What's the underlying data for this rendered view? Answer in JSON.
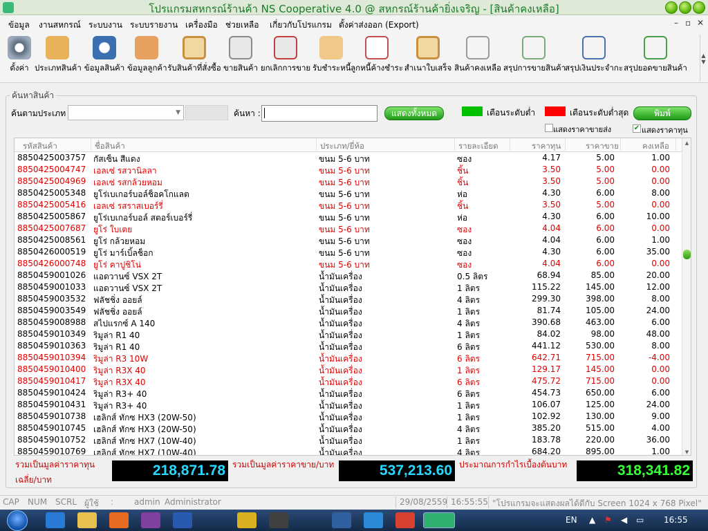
{
  "window": {
    "title": "โปรแกรมสหกรณ์ร้านค้า NS Cooperative 4.0 @ สหกรณ์ร้านค้ายิ่งเจริญ - [สินค้าคงเหลือ]"
  },
  "menu": [
    "ข้อมูล",
    "งานสหกรณ์",
    "ระบบงาน",
    "ระบบรายงาน",
    "เครื่องมือ",
    "ช่วยเหลือ",
    "เกี่ยวกับโปรแกรม",
    "ตั้งค่าส่งออก (Export)"
  ],
  "mdi_controls": [
    "–",
    "▫",
    "✕"
  ],
  "toolbar": [
    {
      "label": "ตั้งค่า",
      "icon": "gear-icon",
      "color": "#6a7a8a"
    },
    {
      "label": "ประเภทสินค้า",
      "icon": "folder-icon",
      "color": "#e8b25a"
    },
    {
      "label": "ข้อมูลสินค้า",
      "icon": "barcode-icon",
      "color": "#3a6fb0"
    },
    {
      "label": "ข้อมูลลูกค้า",
      "icon": "customer-icon",
      "color": "#e8a060"
    },
    {
      "label": "รับสินค้าที่สั่งซื้อ",
      "icon": "clipboard-icon",
      "color": "#d8a850"
    },
    {
      "label": "ขายสินค้า",
      "icon": "cart-icon",
      "color": "#8a8a8a"
    },
    {
      "label": "ยกเลิกการขาย",
      "icon": "cart-cancel-icon",
      "color": "#c04040"
    },
    {
      "label": "รับชำระหนี้",
      "icon": "payment-hand-icon",
      "color": "#e0a848"
    },
    {
      "label": "ลูกหนี้ค้างชำระ",
      "icon": "invoice-icon",
      "color": "#c05050"
    },
    {
      "label": "สำเนาใบเสร็จ",
      "icon": "receipt-copy-icon",
      "color": "#d8a850"
    },
    {
      "label": "สินค้าคงเหลือ",
      "icon": "stock-list-icon",
      "color": "#9a9a9a"
    },
    {
      "label": "สรุปการขายสินค้า",
      "icon": "sales-summary-icon",
      "color": "#7aaa7a"
    },
    {
      "label": "สรุปเงินประจำกะ",
      "icon": "shift-cash-icon",
      "color": "#4a70b0"
    },
    {
      "label": "สรุปยอดขายสินค้า",
      "icon": "sales-chart-icon",
      "color": "#4aa04a"
    }
  ],
  "search": {
    "legend": "ค้นหาสินค้า",
    "type_label": "ค้นตามประเภท",
    "type_value": "",
    "search_label": "ค้นหา :",
    "search_value": "",
    "show_all": "แสดงทั้งหมด",
    "warn_low": "เตือนระดับต่ำ",
    "warn_min": "เตือนระดับต่ำสุด",
    "warn_low_color": "#00c000",
    "warn_min_color": "#ff0000",
    "print": "พิมพ์",
    "show_sell_price": "แสดงราคาขายส่ง",
    "show_sell_price_checked": false,
    "show_cost": "แสดงราคาทุน",
    "show_cost_checked": true
  },
  "table": {
    "columns": [
      "รหัสสินค้า",
      "ชื่อสินค้า",
      "ประเภท/ยี่ห้อ",
      "รายละเอียด",
      "ราคาทุน",
      "ราคาขาย",
      "คงเหลือ"
    ],
    "rows": [
      {
        "c": [
          "8850425003757",
          "กัสเซ็น สีแดง",
          "ขนม 5-6 บาท",
          "ซอง",
          "4.17",
          "5.00",
          "1.00"
        ],
        "red": false
      },
      {
        "c": [
          "8850425004747",
          "เอลเซ่ รสวานิลลา",
          "ขนม 5-6 บาท",
          "ชิ้น",
          "3.50",
          "5.00",
          "0.00"
        ],
        "red": true
      },
      {
        "c": [
          "8850425004969",
          "เอลเซ่ รสกล้วยหอม",
          "ขนม 5-6 บาท",
          "ชิ้น",
          "3.50",
          "5.00",
          "0.00"
        ],
        "red": true
      },
      {
        "c": [
          "8850425005348",
          "ยูโร่เบเกอร์บอล์ช็อคโกแลต",
          "ขนม 5-6 บาท",
          "ห่อ",
          "4.30",
          "6.00",
          "8.00"
        ],
        "red": false
      },
      {
        "c": [
          "8850425005416",
          "เอลเซ่ รสราสเบอร์รี่",
          "ขนม 5-6 บาท",
          "ชิ้น",
          "3.50",
          "5.00",
          "0.00"
        ],
        "red": true
      },
      {
        "c": [
          "8850425005867",
          "ยูโร่เบเกอร์บอล์ สตอร์เบอร์รี่",
          "ขนม 5-6 บาท",
          "ห่อ",
          "4.30",
          "6.00",
          "10.00"
        ],
        "red": false
      },
      {
        "c": [
          "8850425007687",
          "ยูโร่ ใบเตย",
          "ขนม 5-6 บาท",
          "ซอง",
          "4.04",
          "6.00",
          "0.00"
        ],
        "red": true
      },
      {
        "c": [
          "8850425008561",
          "ยูโร่ กล้วยหอม",
          "ขนม 5-6 บาท",
          "ซอง",
          "4.04",
          "6.00",
          "1.00"
        ],
        "red": false
      },
      {
        "c": [
          "8850426000519",
          "ยูโร่ มาร์เบิ้ลช็อก",
          "ขนม 5-6 บาท",
          "ซอง",
          "4.30",
          "6.00",
          "35.00"
        ],
        "red": false
      },
      {
        "c": [
          "8850426000748",
          "ยูโร่ คาปูชิโน่",
          "ขนม 5-6 บาท",
          "ซอง",
          "4.04",
          "6.00",
          "0.00"
        ],
        "red": true
      },
      {
        "c": [
          "8850459001026",
          "แอดวานซ์ VSX 2T",
          "น้ำมันเครื่อง",
          "0.5 ลิตร",
          "68.94",
          "85.00",
          "20.00"
        ],
        "red": false
      },
      {
        "c": [
          "8850459001033",
          "แอดวานซ์ VSX 2T",
          "น้ำมันเครื่อง",
          "1 ลิตร",
          "115.22",
          "145.00",
          "12.00"
        ],
        "red": false
      },
      {
        "c": [
          "8850459003532",
          "ฟลัชชิ่ง ออยล์",
          "น้ำมันเครื่อง",
          "4 ลิตร",
          "299.30",
          "398.00",
          "8.00"
        ],
        "red": false
      },
      {
        "c": [
          "8850459003549",
          "ฟลัชชิ่ง ออยล์",
          "น้ำมันเครื่อง",
          "1 ลิตร",
          "81.74",
          "105.00",
          "24.00"
        ],
        "red": false
      },
      {
        "c": [
          "8850459008988",
          "สไปแรกซ์ A 140",
          "น้ำมันเครื่อง",
          "4 ลิตร",
          "390.68",
          "463.00",
          "6.00"
        ],
        "red": false
      },
      {
        "c": [
          "8850459010349",
          "ริมูล่า R1 40",
          "น้ำมันเครื่อง",
          "1 ลิตร",
          "84.02",
          "98.00",
          "48.00"
        ],
        "red": false
      },
      {
        "c": [
          "8850459010363",
          "ริมูล่า R1 40",
          "น้ำมันเครื่อง",
          "6 ลิตร",
          "441.12",
          "530.00",
          "8.00"
        ],
        "red": false
      },
      {
        "c": [
          "8850459010394",
          "ริมูล่า R3 10W",
          "น้ำมันเครื่อง",
          "6 ลิตร",
          "642.71",
          "715.00",
          "-4.00"
        ],
        "red": true
      },
      {
        "c": [
          "8850459010400",
          "ริมูล่า R3X 40",
          "น้ำมันเครื่อง",
          "1 ลิตร",
          "129.17",
          "145.00",
          "0.00"
        ],
        "red": true
      },
      {
        "c": [
          "8850459010417",
          "ริมูล่า R3X 40",
          "น้ำมันเครื่อง",
          "6 ลิตร",
          "475.72",
          "715.00",
          "0.00"
        ],
        "red": true
      },
      {
        "c": [
          "8850459010424",
          "ริมูล่า R3+ 40",
          "น้ำมันเครื่อง",
          "6 ลิตร",
          "454.73",
          "650.00",
          "6.00"
        ],
        "red": false
      },
      {
        "c": [
          "8850459010431",
          "ริมูล่า R3+ 40",
          "น้ำมันเครื่อง",
          "1 ลิตร",
          "106.07",
          "125.00",
          "24.00"
        ],
        "red": false
      },
      {
        "c": [
          "8850459010738",
          "เฮลิกส์ ทักซ HX3 (20W-50)",
          "น้ำมันเครื่อง",
          "1 ลิตร",
          "102.92",
          "130.00",
          "9.00"
        ],
        "red": false
      },
      {
        "c": [
          "8850459010745",
          "เฮลิกส์ ทักซ HX3 (20W-50)",
          "น้ำมันเครื่อง",
          "4 ลิตร",
          "385.20",
          "515.00",
          "4.00"
        ],
        "red": false
      },
      {
        "c": [
          "8850459010752",
          "เฮลิกส์ ทักซ HX7 (10W-40)",
          "น้ำมันเครื่อง",
          "1 ลิตร",
          "183.78",
          "220.00",
          "36.00"
        ],
        "red": false
      },
      {
        "c": [
          "8850459010769",
          "เฮลิกส์ ทักซ HX7 (10W-40)",
          "น้ำมันเครื่อง",
          "4 ลิตร",
          "684.20",
          "895.00",
          "1.00"
        ],
        "red": false
      }
    ]
  },
  "summary": {
    "cost_label": "รวมเป็นมูลค่าราคาทุนเฉลี่ย/บาท",
    "cost_value": "218,871.78",
    "cost_color": "#28d8ff",
    "sell_label": "รวมเป็นมูลค่าราคาขาย/บาท",
    "sell_value": "537,213.60",
    "sell_color": "#28d8ff",
    "profit_label": "ประมาณการกำไรเบื้องต้นบาท",
    "profit_value": "318,341.82",
    "profit_color": "#38ff38"
  },
  "statusbar": {
    "cap": "CAP",
    "num": "NUM",
    "scrl": "SCRL",
    "user_label": "ผู้ใช้",
    "colon": ":",
    "user": "admin",
    "role": "Administrator",
    "date": "29/08/2559",
    "time": "16:55:55",
    "message": "\"โปรแกรมจะแสดงผลได้ดีกับ  Screen 1024 x 768 Pixel\""
  },
  "taskbar": {
    "lang": "EN",
    "clock": "16:55",
    "apps": [
      {
        "icon": "ie-icon",
        "color": "#2a7ad8"
      },
      {
        "icon": "explorer-icon",
        "color": "#e8c050"
      },
      {
        "icon": "media-player-icon",
        "color": "#e86a20"
      },
      {
        "icon": "onenote-icon",
        "color": "#8040a0"
      },
      {
        "icon": "word-icon",
        "color": "#2a5ab0"
      },
      {
        "icon": "key-icon",
        "color": "#d8b020"
      },
      {
        "icon": "camera-icon",
        "color": "#404040"
      },
      {
        "icon": "mail-icon",
        "color": "#3060a0"
      },
      {
        "icon": "network-icon",
        "color": "#2a8ad8"
      },
      {
        "icon": "chrome-icon",
        "color": "#d84030"
      },
      {
        "icon": "cooperative-app-icon",
        "color": "#30b070"
      }
    ]
  }
}
